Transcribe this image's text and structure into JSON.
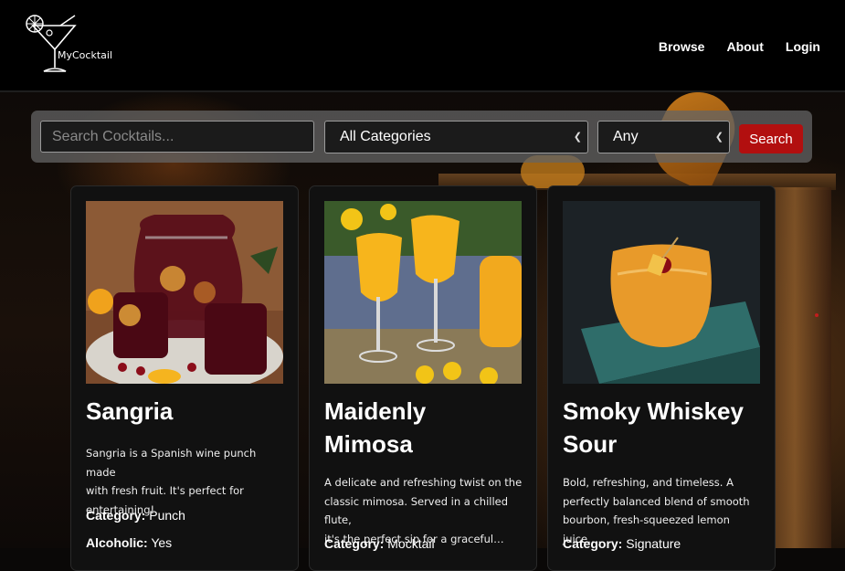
{
  "brand": {
    "name": "MyCocktail"
  },
  "nav": {
    "browse": "Browse",
    "about": "About",
    "login": "Login"
  },
  "search": {
    "placeholder": "Search Cocktails...",
    "category_selected": "All Categories",
    "alcoholic_selected": "Any",
    "button_label": "Search"
  },
  "cards": [
    {
      "title_lines": [
        "Sangria"
      ],
      "description_lines": [
        "Sangria is a Spanish wine punch made",
        "with fresh fruit. It's perfect for",
        "entertaining!"
      ],
      "category_label": "Category:",
      "category": "Punch",
      "alcoholic_label": "Alcoholic:",
      "alcoholic": "Yes"
    },
    {
      "title_lines": [
        "Maidenly",
        "Mimosa"
      ],
      "description_lines": [
        "A delicate and refreshing twist on the",
        "classic mimosa. Served in a chilled flute,",
        "it's the perfect sip for a graceful…"
      ],
      "category_label": "Category:",
      "category": "Mocktail"
    },
    {
      "title_lines": [
        "Smoky Whiskey",
        "Sour"
      ],
      "description_lines": [
        "Bold, refreshing, and timeless. A",
        "perfectly balanced blend of smooth",
        "bourbon, fresh-squeezed lemon juice,…"
      ],
      "category_label": "Category:",
      "category": "Signature"
    }
  ],
  "colors": {
    "accent": "#b20f0f",
    "header_bg": "#000000",
    "card_bg": "#111111"
  }
}
